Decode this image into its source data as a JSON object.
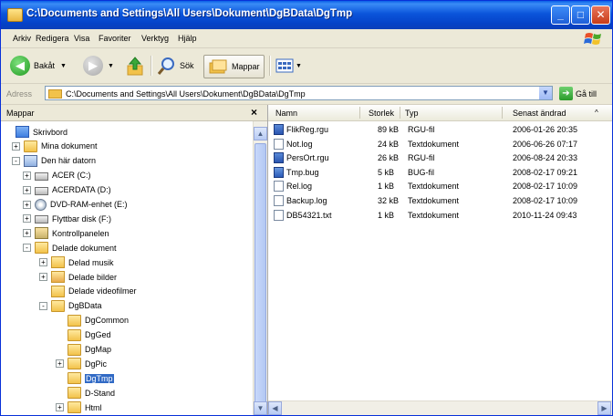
{
  "window": {
    "title": "C:\\Documents and Settings\\All Users\\Dokument\\DgBData\\DgTmp",
    "controls": {
      "minimize": "_",
      "maximize": "□",
      "close": "✕"
    }
  },
  "menu": [
    "Arkiv",
    "Redigera",
    "Visa",
    "Favoriter",
    "Verktyg",
    "Hjälp"
  ],
  "toolbar": {
    "back": "Bakåt",
    "search": "Sök",
    "folders": "Mappar"
  },
  "address": {
    "label": "Adress",
    "path": "C:\\Documents and Settings\\All Users\\Dokument\\DgBData\\DgTmp",
    "go": "Gå till"
  },
  "folder_pane": {
    "title": "Mappar",
    "close": "×",
    "tree": [
      {
        "label": "Skrivbord",
        "icon": "desktop-icon",
        "depth": 0,
        "toggle": ""
      },
      {
        "label": "Mina dokument",
        "icon": "folder-icon",
        "depth": 1,
        "toggle": "+"
      },
      {
        "label": "Den här datorn",
        "icon": "computer-icon",
        "depth": 1,
        "toggle": "-"
      },
      {
        "label": "ACER (C:)",
        "icon": "drive-icon",
        "depth": 2,
        "toggle": "+"
      },
      {
        "label": "ACERDATA (D:)",
        "icon": "drive-icon",
        "depth": 2,
        "toggle": "+"
      },
      {
        "label": "DVD-RAM-enhet (E:)",
        "icon": "cd-icon",
        "depth": 2,
        "toggle": "+"
      },
      {
        "label": "Flyttbar disk (F:)",
        "icon": "drive-icon",
        "depth": 2,
        "toggle": "+"
      },
      {
        "label": "Kontrollpanelen",
        "icon": "control-panel-icon",
        "depth": 2,
        "toggle": "+"
      },
      {
        "label": "Delade dokument",
        "icon": "folder-icon",
        "depth": 2,
        "toggle": "-"
      },
      {
        "label": "Delad musik",
        "icon": "music-folder-icon",
        "depth": 3,
        "toggle": "+"
      },
      {
        "label": "Delade bilder",
        "icon": "pictures-folder-icon",
        "depth": 3,
        "toggle": "+"
      },
      {
        "label": "Delade videofilmer",
        "icon": "video-folder-icon",
        "depth": 3,
        "toggle": ""
      },
      {
        "label": "DgBData",
        "icon": "folder-icon",
        "depth": 3,
        "toggle": "-"
      },
      {
        "label": "DgCommon",
        "icon": "folder-icon",
        "depth": 4,
        "toggle": ""
      },
      {
        "label": "DgGed",
        "icon": "folder-icon",
        "depth": 4,
        "toggle": ""
      },
      {
        "label": "DgMap",
        "icon": "folder-icon",
        "depth": 4,
        "toggle": ""
      },
      {
        "label": "DgPic",
        "icon": "folder-icon",
        "depth": 4,
        "toggle": "+"
      },
      {
        "label": "DgTmp",
        "icon": "folder-icon",
        "depth": 4,
        "toggle": "",
        "selected": true
      },
      {
        "label": "D-Stand",
        "icon": "folder-icon",
        "depth": 4,
        "toggle": ""
      },
      {
        "label": "Html",
        "icon": "folder-icon",
        "depth": 4,
        "toggle": "+"
      }
    ]
  },
  "file_list": {
    "columns": {
      "name": "Namn",
      "size": "Storlek",
      "type": "Typ",
      "modified": "Senast ändrad"
    },
    "sort_arrow": "^",
    "rows": [
      {
        "name": "FlikReg.rgu",
        "size": "89 kB",
        "type": "RGU-fil",
        "modified": "2006-01-26 20:35",
        "icon": "rgu-file-icon"
      },
      {
        "name": "Not.log",
        "size": "24 kB",
        "type": "Textdokument",
        "modified": "2006-06-26 07:17",
        "icon": "text-file-icon"
      },
      {
        "name": "PersOrt.rgu",
        "size": "26 kB",
        "type": "RGU-fil",
        "modified": "2006-08-24 20:33",
        "icon": "rgu-file-icon"
      },
      {
        "name": "Tmp.bug",
        "size": "5 kB",
        "type": "BUG-fil",
        "modified": "2008-02-17 09:21",
        "icon": "bug-file-icon"
      },
      {
        "name": "Rel.log",
        "size": "1 kB",
        "type": "Textdokument",
        "modified": "2008-02-17 10:09",
        "icon": "text-file-icon"
      },
      {
        "name": "Backup.log",
        "size": "32 kB",
        "type": "Textdokument",
        "modified": "2008-02-17 10:09",
        "icon": "text-file-icon"
      },
      {
        "name": "DB54321.txt",
        "size": "1 kB",
        "type": "Textdokument",
        "modified": "2010-11-24 09:43",
        "icon": "text-file-icon"
      }
    ]
  },
  "colors": {
    "titlebar": "#0b55db",
    "selection": "#316ac5",
    "chrome": "#ece9d8"
  }
}
